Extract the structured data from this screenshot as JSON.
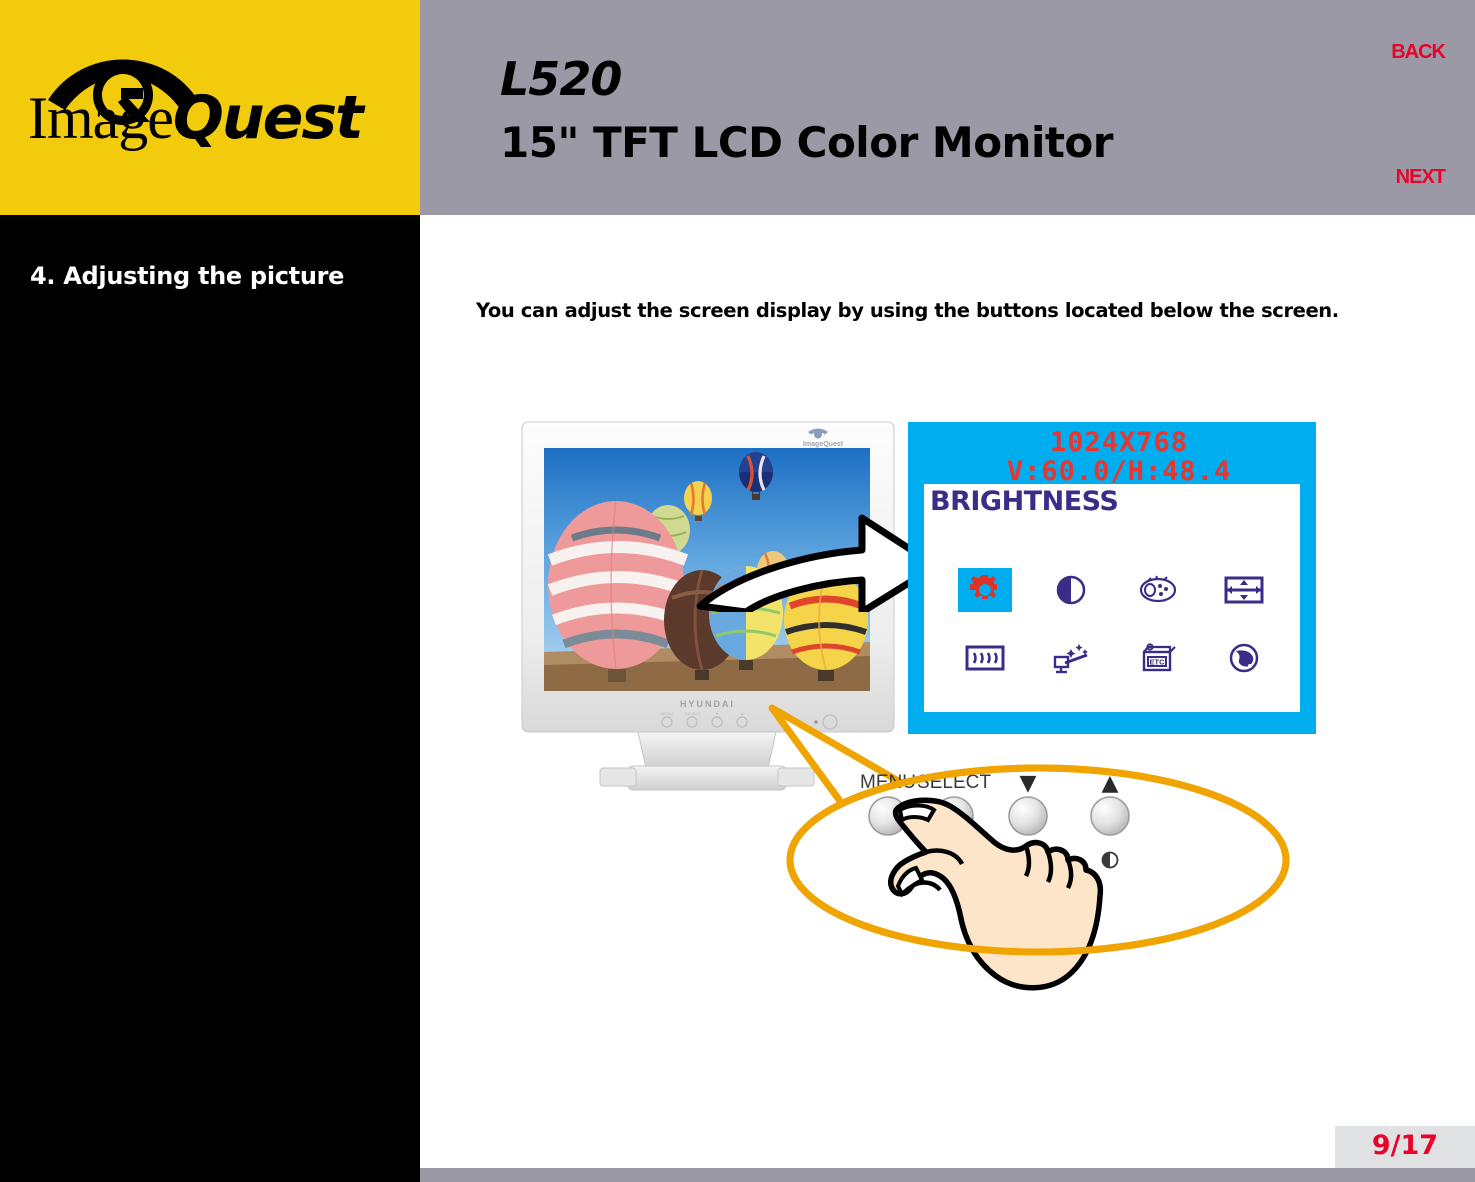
{
  "brand": {
    "logo_word_1": "Image",
    "logo_word_2": "Quest",
    "logo_icon": "eye-logo-icon",
    "logo_bg": "#f2cc0c"
  },
  "header": {
    "model": "L520",
    "subtitle": "15\" TFT LCD Color Monitor",
    "bg": "#9b99a5",
    "nav": {
      "back": "BACK",
      "next": "NEXT",
      "color": "#e8032a"
    }
  },
  "sidebar": {
    "bg": "#000000",
    "section_title": "4. Adjusting the picture"
  },
  "main": {
    "instruction": "You can adjust the screen display by using the buttons located below the screen."
  },
  "monitor": {
    "brand_label": "HYUNDAI",
    "logo_label": "ImageQuest",
    "screen_image": "hot-air-balloons-photo",
    "bezel_color": "#f3f3f3"
  },
  "osd": {
    "bg": "#00adee",
    "panel_bg": "#ffffff",
    "resolution": "1024X768",
    "frequency": "V:60.0/H:48.4",
    "res_color": "#e8352e",
    "menu_label": "BRIGHTNESS",
    "menu_label_color": "#3b2d87",
    "icons": [
      {
        "name": "brightness-icon",
        "selected": true
      },
      {
        "name": "contrast-icon",
        "selected": false
      },
      {
        "name": "color-palette-icon",
        "selected": false
      },
      {
        "name": "size-position-icon",
        "selected": false
      },
      {
        "name": "moire-icon",
        "selected": false
      },
      {
        "name": "auto-adjust-icon",
        "selected": false
      },
      {
        "name": "etc-icon",
        "selected": false,
        "text": "ETC"
      },
      {
        "name": "language-globe-icon",
        "selected": false
      }
    ]
  },
  "callout": {
    "outline_color": "#f0a400",
    "buttons": [
      {
        "label": "MENU",
        "sub_icon": ""
      },
      {
        "label": "SELECT",
        "sub_icon": ""
      },
      {
        "label": "▼",
        "sub_icon": "brightness-sun-icon"
      },
      {
        "label": "▲",
        "sub_icon": "contrast-icon"
      }
    ],
    "hand": "pointing-hand-icon"
  },
  "footer": {
    "page_number": "9/17",
    "page_number_color": "#e8032a",
    "panel_bg": "#e0e1e3",
    "bar_bg": "#9b99a5"
  }
}
